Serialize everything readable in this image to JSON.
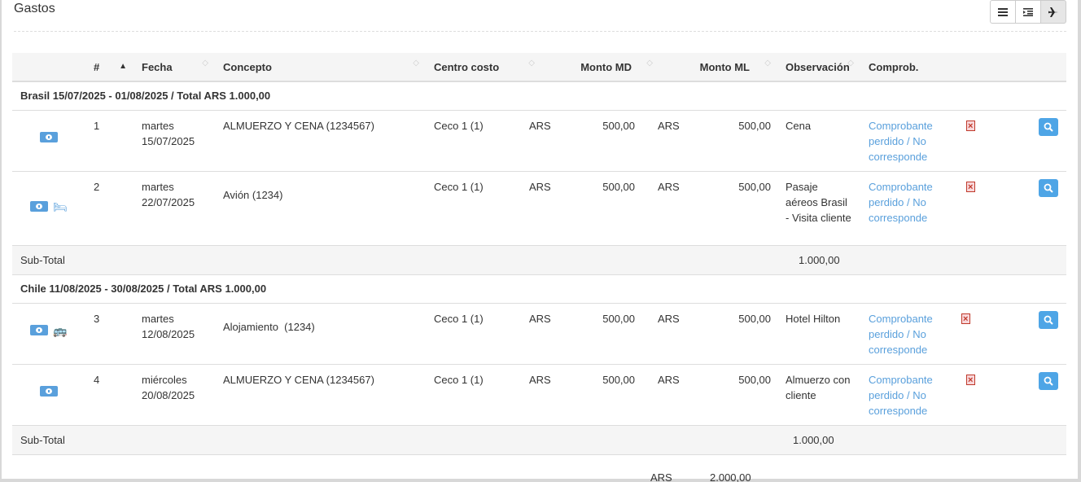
{
  "page": {
    "title": "Gastos"
  },
  "view_buttons": [
    {
      "name": "list-view-button",
      "icon": "list-icon"
    },
    {
      "name": "indent-view-button",
      "icon": "indent-icon"
    },
    {
      "name": "trip-view-button",
      "icon": "plane-icon"
    }
  ],
  "columns": [
    "#",
    "Fecha",
    "Concepto",
    "Centro costo",
    "Monto MD",
    "Monto ML",
    "Observación",
    "Comprob."
  ],
  "groups": [
    {
      "header": "Brasil 15/07/2025 - 01/08/2025 / Total ARS 1.000,00",
      "rows": [
        {
          "num": "1",
          "fecha_day": "martes",
          "fecha_date": "15/07/2025",
          "concepto": "ALMUERZO Y CENA (1234567)",
          "centro": "Ceco 1 (1)",
          "md_cur": "ARS",
          "md_val": "500,00",
          "ml_cur": "ARS",
          "ml_val": "500,00",
          "obs": "Cena",
          "comprob": "Comprobante perdido / No corresponde",
          "icons": [
            "money-icon"
          ]
        },
        {
          "num": "2",
          "fecha_day": "martes",
          "fecha_date": "22/07/2025",
          "concepto": "Avión (1234)",
          "centro": "Ceco 1 (1)",
          "md_cur": "ARS",
          "md_val": "500,00",
          "ml_cur": "ARS",
          "ml_val": "500,00",
          "obs": "Pasaje aéreos Brasil - Visita cliente",
          "comprob": "Comprobante perdido / No corresponde",
          "icons": [
            "money-icon",
            "bed-icon"
          ]
        }
      ],
      "subtotal_label": "Sub-Total",
      "subtotal_value": "1.000,00"
    },
    {
      "header": "Chile 11/08/2025 - 30/08/2025 / Total ARS 1.000,00",
      "rows": [
        {
          "num": "3",
          "fecha_day": "martes",
          "fecha_date": "12/08/2025",
          "concepto": "Alojamiento  (1234)",
          "centro": "Ceco 1 (1)",
          "md_cur": "ARS",
          "md_val": "500,00",
          "ml_cur": "ARS",
          "ml_val": "500,00",
          "obs": "Hotel Hilton",
          "comprob": "Comprobante perdido / No corresponde",
          "icons": [
            "money-icon",
            "bus-icon"
          ]
        },
        {
          "num": "4",
          "fecha_day": "miércoles",
          "fecha_date": "20/08/2025",
          "concepto": "ALMUERZO Y CENA (1234567)",
          "centro": "Ceco 1 (1)",
          "md_cur": "ARS",
          "md_val": "500,00",
          "ml_cur": "ARS",
          "ml_val": "500,00",
          "obs": "Almuerzo con cliente",
          "comprob": "Comprobante perdido / No corresponde",
          "icons": [
            "money-icon"
          ]
        }
      ],
      "subtotal_label": "Sub-Total",
      "subtotal_value": "1.000,00"
    }
  ],
  "grand_total": {
    "currency": "ARS",
    "value": "2.000,00"
  },
  "colors": {
    "link": "#5aa0dc",
    "search_button": "#4ea5e6",
    "pdf_icon": "#c0392b"
  }
}
